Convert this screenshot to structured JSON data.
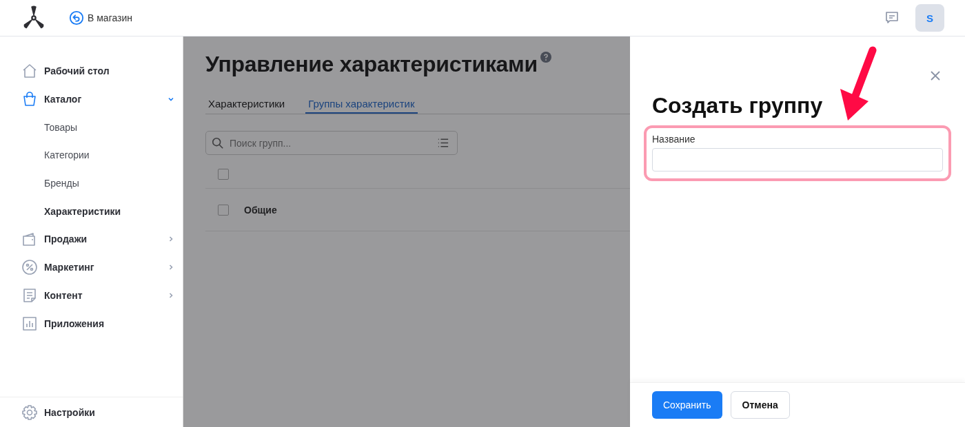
{
  "header": {
    "back_link": "В магазин",
    "avatar": "S"
  },
  "sidebar": {
    "items": [
      {
        "label": "Рабочий стол",
        "kind": "house",
        "selected": false
      },
      {
        "label": "Каталог",
        "kind": "bag",
        "selected": true,
        "expanded": true,
        "children": [
          {
            "label": "Товары",
            "selected": false
          },
          {
            "label": "Категории",
            "selected": false
          },
          {
            "label": "Бренды",
            "selected": false
          },
          {
            "label": "Характеристики",
            "selected": true
          }
        ]
      },
      {
        "label": "Продажи",
        "kind": "wallet",
        "selected": false,
        "expanded": false
      },
      {
        "label": "Маркетинг",
        "kind": "percent",
        "selected": false,
        "expanded": false
      },
      {
        "label": "Контент",
        "kind": "document",
        "selected": false,
        "expanded": false
      },
      {
        "label": "Приложения",
        "kind": "chart",
        "selected": false
      }
    ],
    "settings": "Настройки"
  },
  "page": {
    "title": "Управление характеристиками",
    "tabs": [
      {
        "label": "Характеристики",
        "selected": false
      },
      {
        "label": "Группы характеристик",
        "selected": true
      }
    ],
    "search": {
      "placeholder": "Поиск групп..."
    },
    "table": {
      "header_checked": false,
      "rows": [
        {
          "name": "Общие",
          "checked": false
        }
      ]
    }
  },
  "drawer": {
    "title": "Создать группу",
    "field": {
      "label": "Название"
    },
    "buttons": [
      {
        "label": "Сохранить",
        "kind": "primary"
      },
      {
        "label": "Отмена",
        "kind": "secondary"
      }
    ]
  }
}
